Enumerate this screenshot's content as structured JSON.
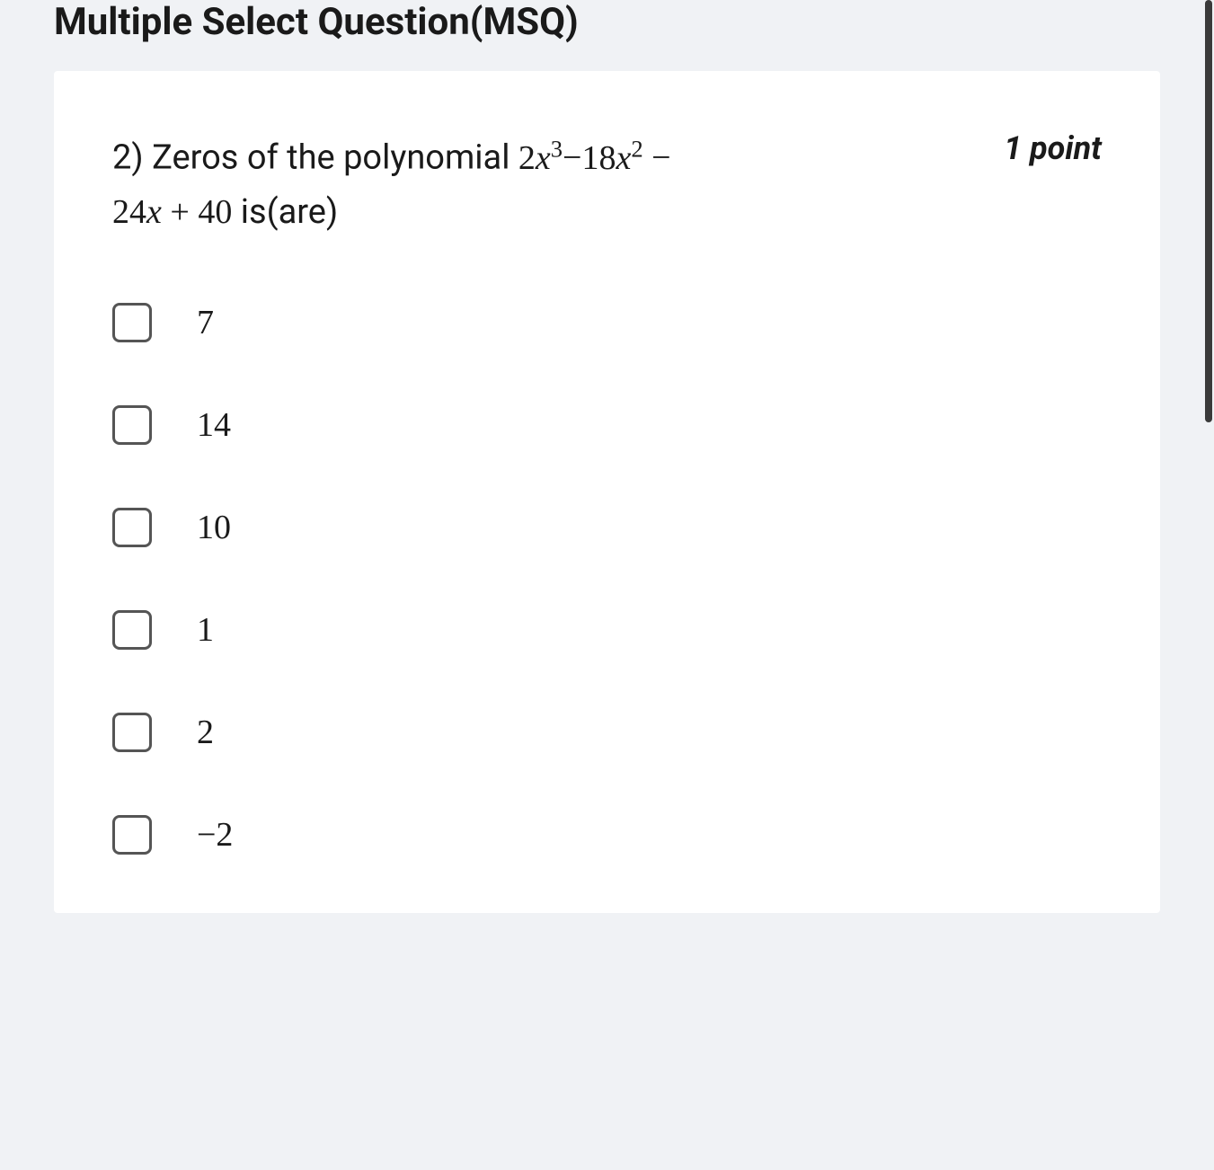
{
  "section_title": "Multiple Select Question(MSQ)",
  "question": {
    "number": "2)",
    "prefix": "Zeros of the polynomial ",
    "poly_term1_coef": "2",
    "poly_term1_var": "x",
    "poly_term1_exp": "3",
    "poly_op1": "−",
    "poly_term2_coef": "18",
    "poly_term2_var": "x",
    "poly_term2_exp": "2",
    "poly_op2": " − ",
    "poly_term3_coef": "24",
    "poly_term3_var": "x",
    "poly_op3": " + ",
    "poly_term4": "40",
    "suffix": " is(are)",
    "points": "1 point"
  },
  "options": [
    {
      "label": "7"
    },
    {
      "label": "14"
    },
    {
      "label": "10"
    },
    {
      "label": "1"
    },
    {
      "label": "2"
    },
    {
      "label": "−2"
    }
  ]
}
